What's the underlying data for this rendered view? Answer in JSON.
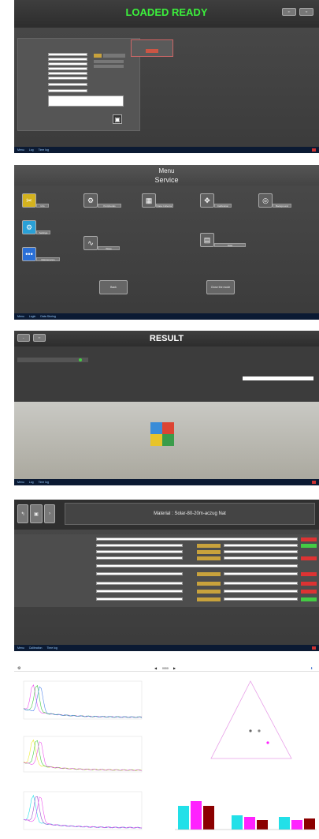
{
  "panel1": {
    "title": "LOADED READY",
    "save_icon": "save-icon",
    "taskbar": [
      "Menu",
      "Log",
      "Time log"
    ]
  },
  "panel2": {
    "menu_title": "Menu",
    "service_title": "Service",
    "buttons": [
      {
        "label": "Info",
        "icon": "wrench-icon",
        "color": "#d4b21e"
      },
      {
        "label": "Peripherals",
        "icon": "devices-icon",
        "color": "#606060"
      },
      {
        "label": "Data Collector",
        "icon": "grid-icon",
        "color": "#606060"
      },
      {
        "label": "Calibration",
        "icon": "calibrate-icon",
        "color": "#606060"
      },
      {
        "label": "Background",
        "icon": "globe-icon",
        "color": "#606060"
      },
      {
        "label": "Settings",
        "icon": "gear-icon",
        "color": "#2aa0d6"
      },
      {
        "label": "Wave",
        "icon": "wave-icon",
        "color": "#606060"
      },
      {
        "label": "Maintenance",
        "icon": "dots-icon",
        "color": "#2a6fd6"
      },
      {
        "label": "Data",
        "icon": "data-icon",
        "color": "#606060"
      }
    ],
    "back_label": "Back",
    "exit_label": "Close the mode",
    "taskbar": [
      "Menu",
      "Login",
      "Data Storing"
    ]
  },
  "panel3": {
    "title": "RESULT",
    "taskbar": [
      "Menu",
      "Log",
      "Time log"
    ]
  },
  "panel4": {
    "header_text": "Material : Solar-80-20m-aczug Nat",
    "taskbar": [
      "Menu",
      "Calibration",
      "Time log"
    ]
  },
  "panel5": {
    "nav_value": "0000",
    "colors": {
      "pink": "#ee55ee",
      "green": "#44cc44",
      "blue": "#5588ee",
      "purple": "#9955cc",
      "cyan": "#22e0e8",
      "magenta": "#ff22ff",
      "maroon": "#8b0000",
      "yellow": "#eeee33"
    }
  }
}
